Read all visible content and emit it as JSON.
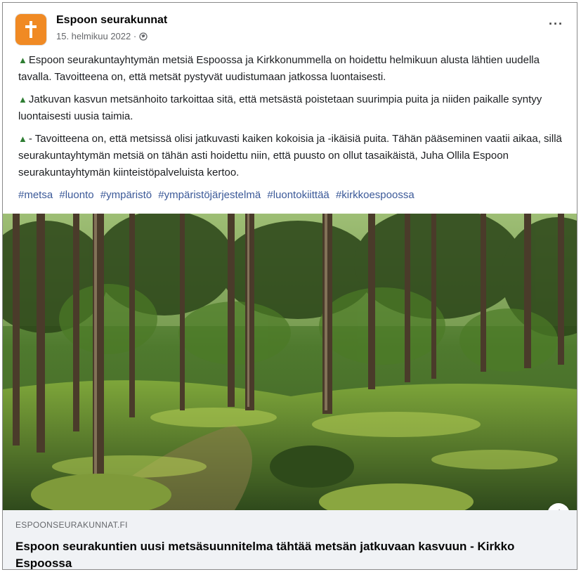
{
  "post": {
    "page_name": "Espoon seurakunnat",
    "date": "15. helmikuu 2022 ·",
    "more_label": "···",
    "paragraphs": [
      "Espoon seurakuntayhtymän metsiä Espoossa ja Kirkkonummella on hoidettu helmikuun alusta lähtien uudella tavalla. Tavoitteena on, että metsät pystyvät uudistumaan jatkossa luontaisesti.",
      "Jatkuvan kasvun metsänhoito tarkoittaa sitä, että metsästä poistetaan suurimpia puita ja niiden paikalle syntyy luontaisesti uusia taimia.",
      "- Tavoitteena on, että metsissä olisi jatkuvasti kaiken kokoisia ja -ikäisiä puita. Tähän pääseminen vaatii aikaa, sillä seurakuntayhtymän metsiä on tähän asti hoidettu niin, että puusto on ollut tasaikäistä, Juha Ollila Espoon seurakuntayhtymän kiinteistöpalveluista kertoo."
    ],
    "hashtags": [
      "#metsa",
      "#luonto",
      "#ympäristö",
      "#ympäristöjärjestelmä",
      "#luontokiittää",
      "#kirkkoespoossa"
    ]
  },
  "link_preview": {
    "domain": "ESPOONSEURAKUNNAT.FI",
    "title": "Espoon seurakuntien uusi metsäsuunnitelma tähtää metsän jatkuvaan kasvuun - Kirkko Espoossa",
    "info_label": "i"
  },
  "colors": {
    "avatar": "#f08a24",
    "hashtag": "#3b5998",
    "tree_emoji": "#2e7d32"
  }
}
